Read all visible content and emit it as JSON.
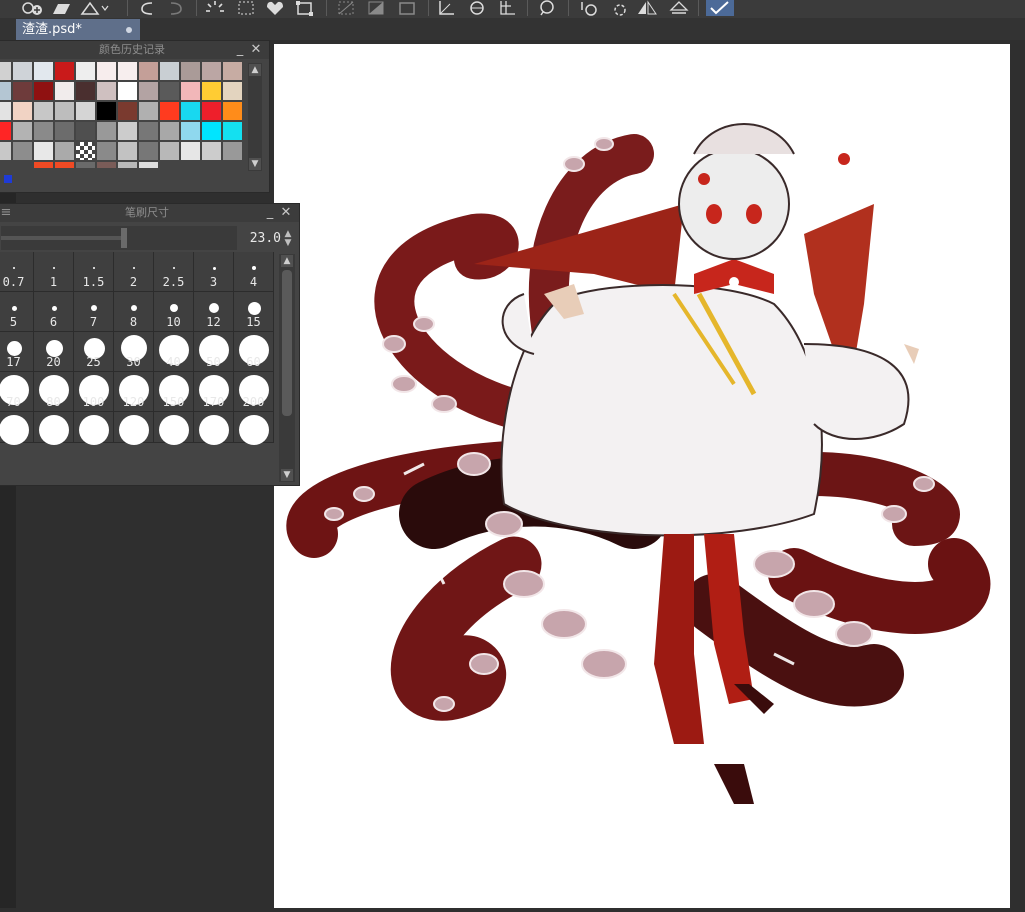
{
  "document_tab": {
    "filename": "渣渣.psd*"
  },
  "color_history": {
    "title": "颜色历史记录",
    "rows": [
      [
        "#d1d1d1",
        "#cfd3d8",
        "#e2e8ee",
        "#c91a1a",
        "#eeeeee",
        "#f7eded",
        "#f7eeee",
        "#c49f98",
        "#c9cfd3",
        "#aa9b98",
        "#bba6a4",
        "#c7aca3"
      ],
      [
        "#b4c6d3",
        "#6e3b3b",
        "#8f1111",
        "#f1ecec",
        "#4a2f2f",
        "#cfc0c0",
        "#ffffff",
        "#b3a3a3",
        "#5a5a5a",
        "#f2b7b9",
        "#ffcc33",
        "#e3d4bf"
      ],
      [
        "#e3e3e3",
        "#f1d3c4",
        "#c7c7c7",
        "#bdbdbd",
        "#d5d5d5",
        "#000000",
        "#7a3a2f",
        "#b0b0b0",
        "#ff3b1f",
        "#18d8f0",
        "#ee1f2b",
        "#ff8c1a"
      ],
      [
        "#ff2525",
        "#b3b3b3",
        "#8a8a8a",
        "#6c6c6c",
        "#4f4f4f",
        "#999999",
        "#cccccc",
        "#777777",
        "#a8a8a8",
        "#8fd8ee",
        "#00e5ff",
        "#14e0f0"
      ],
      [
        "#c8c8c8",
        "#8d8d8d",
        "#e8e8e8",
        "#aaaaaa",
        "checker",
        "#8a8a8a",
        "#c2c2c2",
        "#777777",
        "#b8b8b8",
        "#e6e6e6",
        "#cccccc",
        "#999999"
      ]
    ],
    "extra_row": [
      "#f04a24",
      "#f04a24",
      "#6a6a6a",
      "#7a5c58",
      "#b9b9b9",
      "#dddddd"
    ],
    "selected_color": "#1f3bd6"
  },
  "brush_size": {
    "title": "笔刷尺寸",
    "value": "23.0",
    "presets": [
      [
        "0.7",
        "1",
        "1.5",
        "2",
        "2.5",
        "3",
        "4"
      ],
      [
        "5",
        "6",
        "7",
        "8",
        "10",
        "12",
        "15"
      ],
      [
        "17",
        "20",
        "25",
        "30",
        "40",
        "50",
        "60"
      ],
      [
        "70",
        "80",
        "100",
        "120",
        "150",
        "170",
        "200"
      ],
      [
        "",
        "",
        "",
        "",
        "",
        "",
        ""
      ]
    ]
  },
  "colors": {
    "app_bg": "#2f2f2f",
    "panel_bg": "#444444",
    "tab_active": "#5f6f8a",
    "paper": "#ffffff"
  }
}
